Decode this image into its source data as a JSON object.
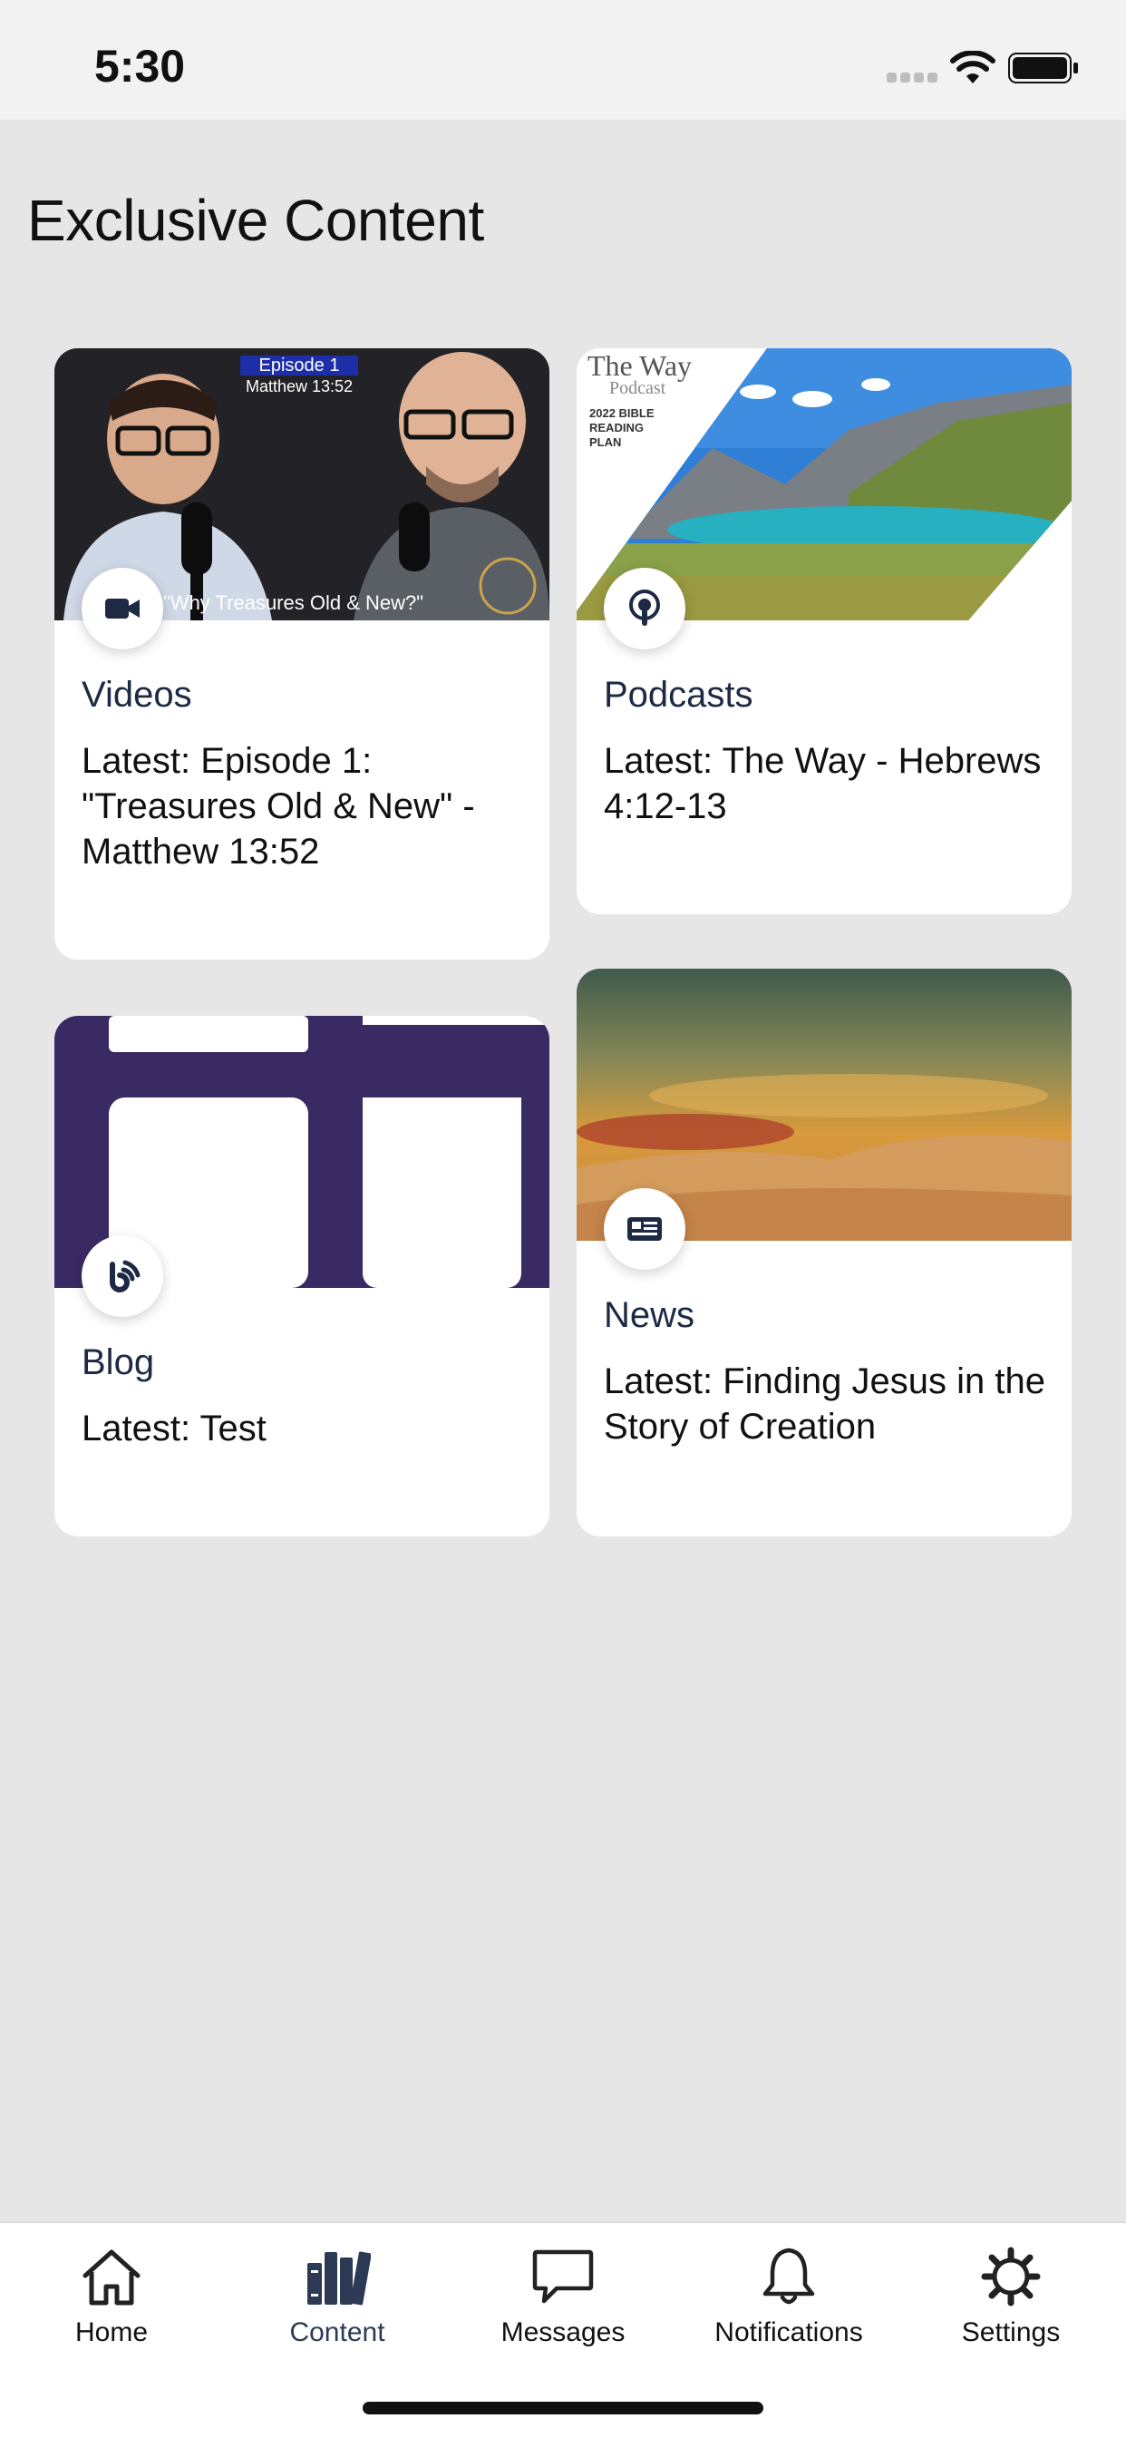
{
  "status_bar": {
    "time": "5:30"
  },
  "page": {
    "title": "Exclusive Content"
  },
  "cards": [
    {
      "category": "Videos",
      "latest": "Latest: Episode 1: \"Treasures Old & New\" - Matthew 13:52",
      "icon": "video-camera-icon",
      "thumbnail": {
        "episode_tag": "Episode 1",
        "reference": "Matthew 13:52",
        "caption": "\"Why Treasures Old & New?\""
      }
    },
    {
      "category": "Podcasts",
      "latest": "Latest: The Way - Hebrews 4:12-13",
      "icon": "podcast-icon",
      "thumbnail": {
        "title": "The Way",
        "subtitle": "Podcast",
        "plan_line1": "2022 BIBLE",
        "plan_line2": "READING",
        "plan_line3": "PLAN"
      }
    },
    {
      "category": "Blog",
      "latest": "Latest: Test",
      "icon": "blog-feed-icon"
    },
    {
      "category": "News",
      "latest": "Latest: Finding Jesus in the Story of Creation",
      "icon": "newspaper-icon"
    }
  ],
  "tabs": [
    {
      "label": "Home",
      "icon": "home-icon",
      "active": false
    },
    {
      "label": "Content",
      "icon": "library-icon",
      "active": true
    },
    {
      "label": "Messages",
      "icon": "chat-bubble-icon",
      "active": false
    },
    {
      "label": "Notifications",
      "icon": "bell-icon",
      "active": false
    },
    {
      "label": "Settings",
      "icon": "gear-icon",
      "active": false
    }
  ],
  "colors": {
    "background": "#e6e6e6",
    "card": "#ffffff",
    "category_text": "#1e2a44",
    "active_tab": "#2c3a55",
    "blog_purple": "#3a2a63"
  }
}
